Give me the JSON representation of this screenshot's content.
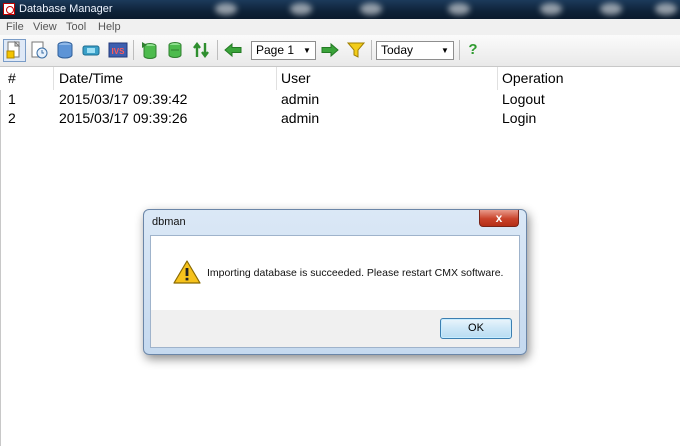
{
  "window": {
    "title": "Database Manager"
  },
  "menu": [
    "File",
    "View",
    "Tool",
    "Help"
  ],
  "toolbar": {
    "page_select": "Page 1",
    "date_select": "Today",
    "help_glyph": "?"
  },
  "table": {
    "headers": [
      "#",
      "Date/Time",
      "User",
      "Operation"
    ],
    "rows": [
      {
        "num": "1",
        "datetime": "2015/03/17 09:39:42",
        "user": "admin",
        "operation": "Logout"
      },
      {
        "num": "2",
        "datetime": "2015/03/17 09:39:26",
        "user": "admin",
        "operation": "Login"
      }
    ]
  },
  "dialog": {
    "title": "dbman",
    "close_glyph": "x",
    "message": "Importing database is succeeded.  Please restart CMX software.",
    "ok_label": "OK"
  },
  "colors": {
    "titlebar": "#0e2238",
    "nav_arrow": "#3aa33a",
    "filter": "#e3b400",
    "close_button": "#c9432b"
  }
}
